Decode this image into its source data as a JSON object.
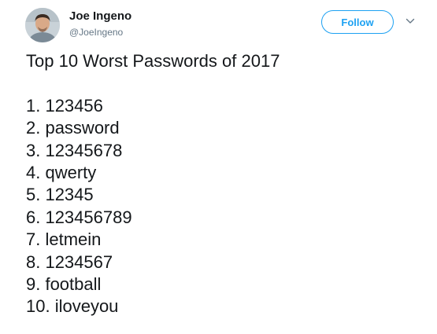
{
  "author": {
    "display_name": "Joe Ingeno",
    "handle": "@JoeIngeno"
  },
  "actions": {
    "follow_label": "Follow",
    "menu_icon": "chevron-down-icon"
  },
  "tweet": {
    "title": "Top 10 Worst Passwords of 2017",
    "passwords": [
      "1. 123456",
      "2. password",
      "3. 12345678",
      "4. qwerty",
      "5. 12345",
      "6. 123456789",
      "7. letmein",
      "8. 1234567",
      "9. football",
      "10. iloveyou"
    ]
  },
  "colors": {
    "accent": "#1da1f2",
    "text": "#14171a",
    "muted": "#657786"
  }
}
